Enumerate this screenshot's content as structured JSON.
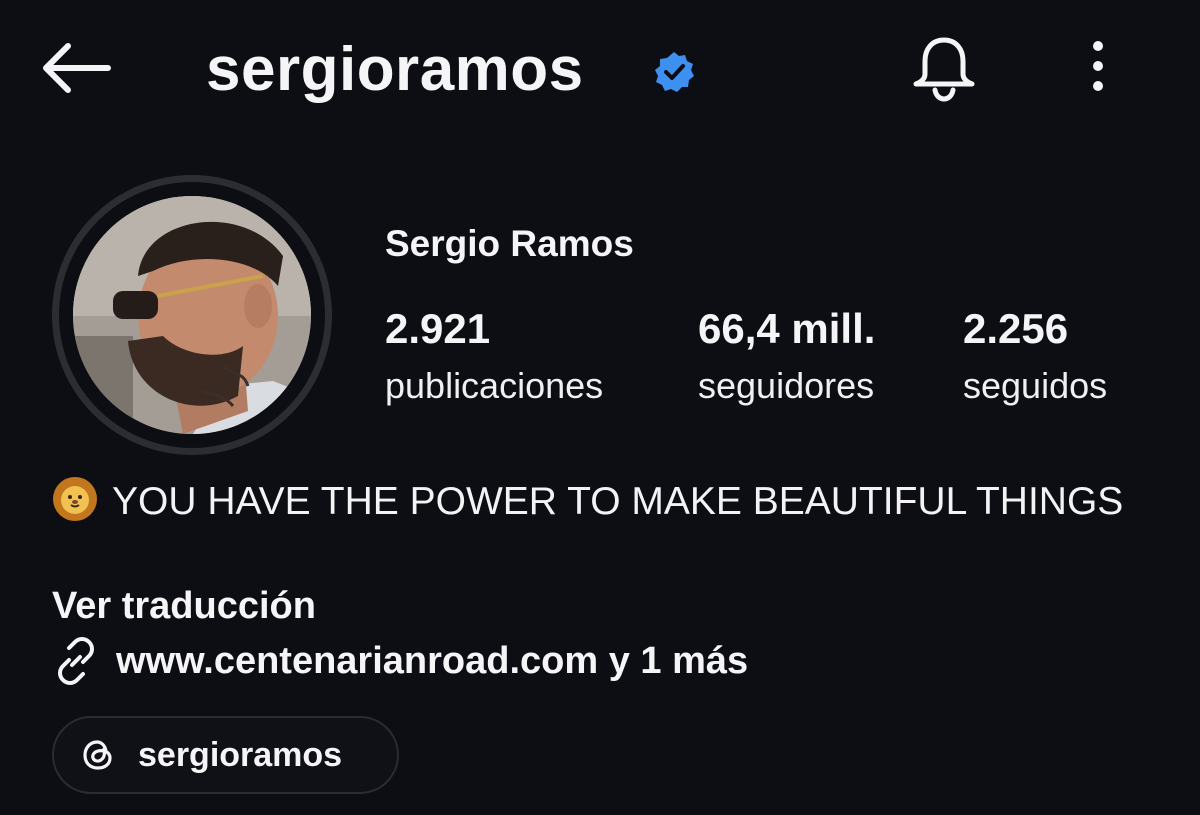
{
  "header": {
    "back_icon": "arrow-left-icon",
    "username": "sergioramos",
    "verified_icon": "verified-badge-icon",
    "notifications_icon": "bell-icon",
    "more_icon": "more-vertical-icon",
    "verified_color": "#3897f0"
  },
  "profile": {
    "avatar_alt": "Profile photo of Sergio Ramos",
    "full_name": "Sergio Ramos",
    "stats": [
      {
        "value": "2.921",
        "label": "publicaciones"
      },
      {
        "value": "66,4 mill.",
        "label": "seguidores"
      },
      {
        "value": "2.256",
        "label": "seguidos"
      }
    ]
  },
  "bio": {
    "emoji_icon": "lion-emoji-icon",
    "text": "YOU HAVE THE POWER TO MAKE BEAUTIFUL THINGS",
    "translate_label": "Ver traducción",
    "link_icon": "link-icon",
    "link_text": "www.centenarianroad.com y 1 más"
  },
  "threads": {
    "icon": "threads-icon",
    "handle": "sergioramos"
  }
}
